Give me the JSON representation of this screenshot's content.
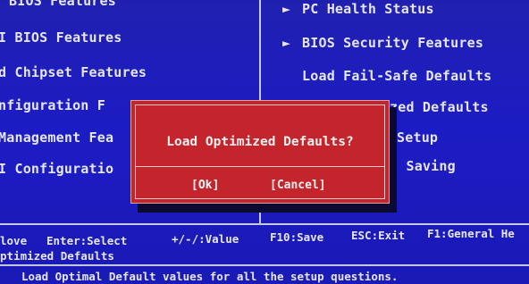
{
  "left_menu": {
    "items": [
      {
        "label": "BIOS Features"
      },
      {
        "label": "I BIOS Features"
      },
      {
        "label": "d Chipset Features"
      },
      {
        "label": "nfiguration F"
      },
      {
        "label": "Management Fea"
      },
      {
        "label": "I Configuratio"
      }
    ]
  },
  "right_menu": {
    "items": [
      {
        "arrow": "►",
        "label": "PC Health Status"
      },
      {
        "arrow": "►",
        "label": "BIOS Security Features"
      },
      {
        "arrow": "",
        "label": "Load Fail-Safe Defaults"
      },
      {
        "arrow": "",
        "label": "zed Defaults"
      },
      {
        "arrow": "",
        "label": "Setup"
      },
      {
        "arrow": "",
        "label": "t Saving"
      }
    ]
  },
  "dialog": {
    "title": "Load Optimized Defaults?",
    "ok_label": "[Ok]",
    "cancel_label": "[Cancel]"
  },
  "key_help": {
    "move": "love",
    "enter": "Enter:Select",
    "value": "+/-/:Value",
    "save": "F10:Save",
    "exit": "ESC:Exit",
    "help": "F1:General He"
  },
  "selected_item_label": "ptimized Defaults",
  "description": "Load Optimal Default values for all the setup questions."
}
